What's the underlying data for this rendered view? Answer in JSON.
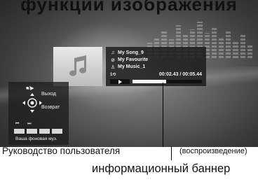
{
  "header": {
    "cropped_title": "функции изображения"
  },
  "player": {
    "song": "My Song_9",
    "album": "My Favourite",
    "artist": "My Music_1",
    "repeat": "1⟲",
    "time": "00:02.43 / 00:05.44",
    "progress": 0.48
  },
  "guide": {
    "play_pause": "■/▶",
    "exit": "Выход",
    "back": "Возврат",
    "skip": "⏮ ⏭",
    "bg_music": "Ваша фоновая муз."
  },
  "captions": {
    "user_guide": "Руководство пользователя",
    "playback": "(воспроизведение)",
    "info_banner": "информационный баннер"
  },
  "icons": [
    "note-icon",
    "album-icon",
    "artist-icon",
    "repeat-icon",
    "play-icon",
    "dpad-icon"
  ]
}
